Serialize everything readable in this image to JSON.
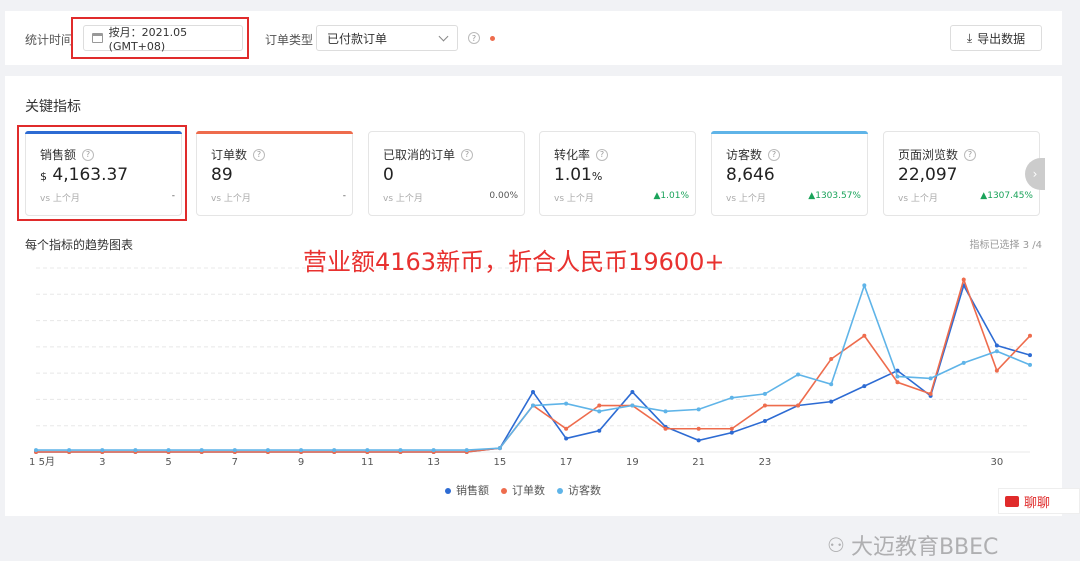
{
  "filters": {
    "time_label": "统计时间",
    "date_value": "按月：2021.05 (GMT+08)",
    "order_type_label": "订单类型",
    "order_type_value": "已付款订单",
    "export_label": "导出数据"
  },
  "metrics": {
    "section_title": "关键指标",
    "cards": [
      {
        "title": "销售额",
        "currency": "$",
        "value": "4,163.37",
        "vs": "vs 上个月",
        "change": "-",
        "up": false,
        "bar": "#2d6bd3"
      },
      {
        "title": "订单数",
        "currency": "",
        "value": "89",
        "vs": "vs 上个月",
        "change": "-",
        "up": false,
        "bar": "#ee6c4d"
      },
      {
        "title": "已取消的订单",
        "currency": "",
        "value": "0",
        "vs": "vs 上个月",
        "change": "0.00%",
        "up": false,
        "bar": ""
      },
      {
        "title": "转化率",
        "currency": "",
        "value": "1.01",
        "suffix": "%",
        "vs": "vs 上个月",
        "change": "▲1.01%",
        "up": true,
        "bar": ""
      },
      {
        "title": "访客数",
        "currency": "",
        "value": "8,646",
        "vs": "vs 上个月",
        "change": "▲1303.57%",
        "up": true,
        "bar": "#5fb4e8"
      },
      {
        "title": "页面浏览数",
        "currency": "",
        "value": "22,097",
        "vs": "vs 上个月",
        "change": "▲1307.45%",
        "up": true,
        "bar": ""
      }
    ]
  },
  "chart": {
    "title": "每个指标的趋势图表",
    "selected": "指标已选择 3 /4",
    "annotation": "营业额4163新币，折合人民币19600+"
  },
  "chart_data": {
    "type": "line",
    "x": [
      1,
      2,
      3,
      4,
      5,
      6,
      7,
      8,
      9,
      10,
      11,
      12,
      13,
      14,
      15,
      16,
      17,
      18,
      19,
      20,
      21,
      22,
      23,
      24,
      25,
      26,
      27,
      28,
      29,
      30,
      31
    ],
    "x_tick_labels": [
      "1 5月",
      "3",
      "5",
      "7",
      "9",
      "11",
      "13",
      "15",
      "17",
      "19",
      "21",
      "23",
      "30"
    ],
    "series": [
      {
        "name": "销售额",
        "color": "#2d6bd3",
        "values": [
          0,
          0,
          0,
          0,
          0,
          0,
          0,
          0,
          0,
          0,
          0,
          0,
          0,
          0,
          2,
          31,
          7,
          11,
          31,
          13,
          6,
          10,
          16,
          24,
          26,
          34,
          42,
          29,
          86,
          55,
          50
        ]
      },
      {
        "name": "订单数",
        "color": "#ee6c4d",
        "values": [
          0,
          0,
          0,
          0,
          0,
          0,
          0,
          0,
          0,
          0,
          0,
          0,
          0,
          0,
          2,
          24,
          12,
          24,
          24,
          12,
          12,
          12,
          24,
          24,
          48,
          60,
          36,
          30,
          89,
          42,
          60
        ]
      },
      {
        "name": "访客数",
        "color": "#5fb4e8",
        "values": [
          1,
          1,
          1,
          1,
          1,
          1,
          1,
          1,
          1,
          1,
          1,
          1,
          1,
          1,
          2,
          24,
          25,
          21,
          24,
          21,
          22,
          28,
          30,
          40,
          35,
          86,
          39,
          38,
          46,
          52,
          45
        ]
      }
    ]
  },
  "watermark": "大迈教育BBEC",
  "chat_label": "聊聊"
}
